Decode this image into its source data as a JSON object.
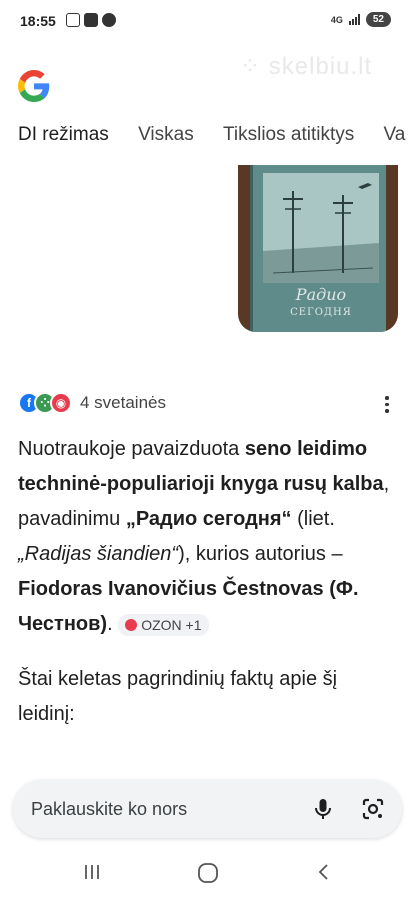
{
  "status_bar": {
    "time": "18:55",
    "network": "4G",
    "battery": "52"
  },
  "watermark": "skelbiu.lt",
  "tabs": [
    "DI režimas",
    "Viskas",
    "Tikslios atitiktys",
    "Va"
  ],
  "book": {
    "title": "Радио",
    "subtitle": "СЕГОДНЯ"
  },
  "sources": {
    "count_label": "4 svetainės"
  },
  "answer": {
    "p1_a": "Nuotraukoje pavaizduota ",
    "p1_b": "seno leidimo techninė-populiarioji knyga rusų kalba",
    "p1_c": ", pavadinimu ",
    "p1_d": "„Радио сегодня“",
    "p1_e": " (liet. ",
    "p1_f": "„Radijas šiandien“",
    "p1_g": "), kurios autorius – ",
    "p1_h": "Fiodoras Ivanovičius Čestnovas (Ф. Честнов)",
    "p1_i": ". ",
    "chip": "OZON +1",
    "p2": "Štai keletas pagrindinių faktų apie šį leidinį:"
  },
  "search": {
    "placeholder": "Paklauskite ko nors"
  },
  "colors": {
    "google_blue": "#4285F4",
    "google_red": "#EA4335",
    "google_yellow": "#FBBC05",
    "google_green": "#34A853"
  }
}
